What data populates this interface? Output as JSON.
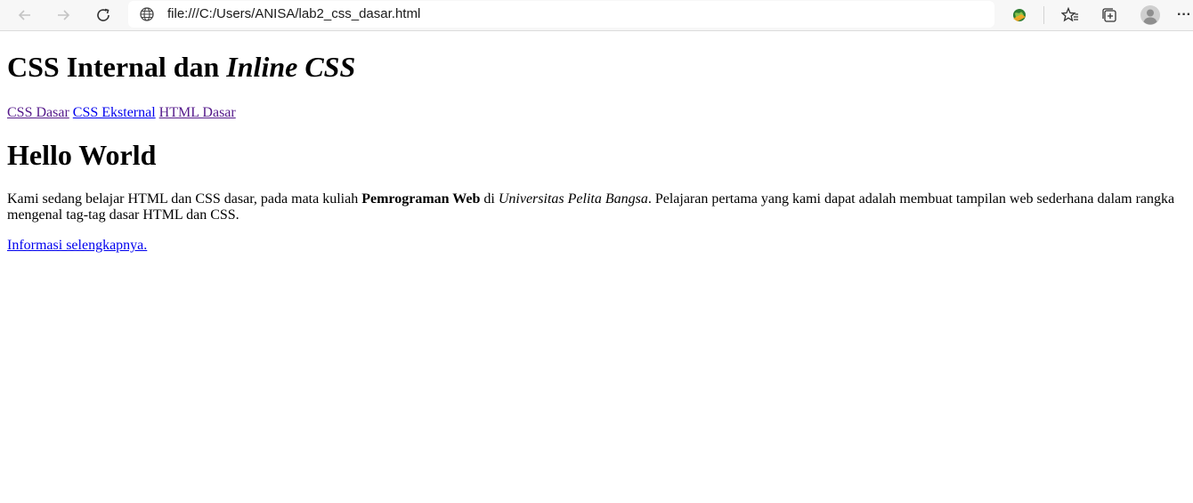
{
  "browser": {
    "url": "file:///C:/Users/ANISA/lab2_css_dasar.html",
    "more_label": "···"
  },
  "page": {
    "title_normal": "CSS Internal dan ",
    "title_italic": "Inline CSS",
    "nav": [
      {
        "label": "CSS Dasar"
      },
      {
        "label": "CSS Eksternal"
      },
      {
        "label": "HTML Dasar"
      }
    ],
    "heading": "Hello World",
    "paragraph": {
      "part1": "Kami sedang belajar HTML dan CSS dasar, pada mata kuliah ",
      "bold": "Pemrograman Web",
      "part2": " di ",
      "italic": "Universitas Pelita Bangsa",
      "part3": ". Pelajaran pertama yang kami dapat adalah membuat tampilan web sederhana dalam rangka mengenal tag-tag dasar HTML dan CSS."
    },
    "more_link": "Informasi selengkapnya."
  },
  "colors": {
    "link": "#0000ee",
    "visited_link": "#551a8b",
    "toolbar_bg": "#f7f7f7"
  }
}
